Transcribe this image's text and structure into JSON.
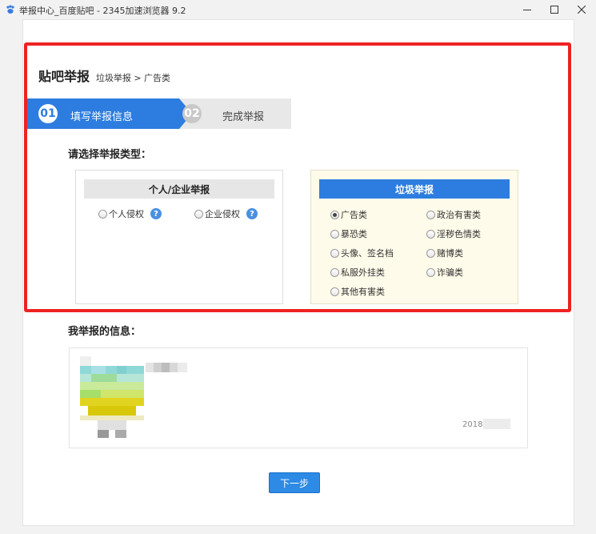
{
  "window": {
    "title": "举报中心_百度贴吧 - 2345加速浏览器 9.2",
    "controls": [
      "minimize",
      "maximize",
      "close"
    ]
  },
  "header": {
    "title": "贴吧举报",
    "breadcrumb": "垃圾举报 > 广告类"
  },
  "steps": [
    {
      "number": "01",
      "label": "填写举报信息",
      "active": true
    },
    {
      "number": "02",
      "label": "完成举报",
      "active": false
    }
  ],
  "report_type": {
    "prompt": "请选择举报类型：",
    "personal": {
      "title": "个人/企业举报",
      "options": [
        {
          "label": "个人侵权",
          "checked": false,
          "help": "?"
        },
        {
          "label": "企业侵权",
          "checked": false,
          "help": "?"
        }
      ]
    },
    "spam": {
      "title": "垃圾举报",
      "options": [
        {
          "label": "广告类",
          "checked": true
        },
        {
          "label": "政治有害类",
          "checked": false
        },
        {
          "label": "暴恐类",
          "checked": false
        },
        {
          "label": "淫秽色情类",
          "checked": false
        },
        {
          "label": "头像、签名档",
          "checked": false
        },
        {
          "label": "赌博类",
          "checked": false
        },
        {
          "label": "私服外挂类",
          "checked": false
        },
        {
          "label": "诈骗类",
          "checked": false
        },
        {
          "label": "其他有害类",
          "checked": false
        }
      ]
    }
  },
  "my_info": {
    "label": "我举报的信息：",
    "date": "2018-0"
  },
  "next_button": "下一步",
  "colors": {
    "accent": "#2d7de0",
    "highlight": "#ee2222",
    "spam_box_bg": "#fffbea"
  }
}
